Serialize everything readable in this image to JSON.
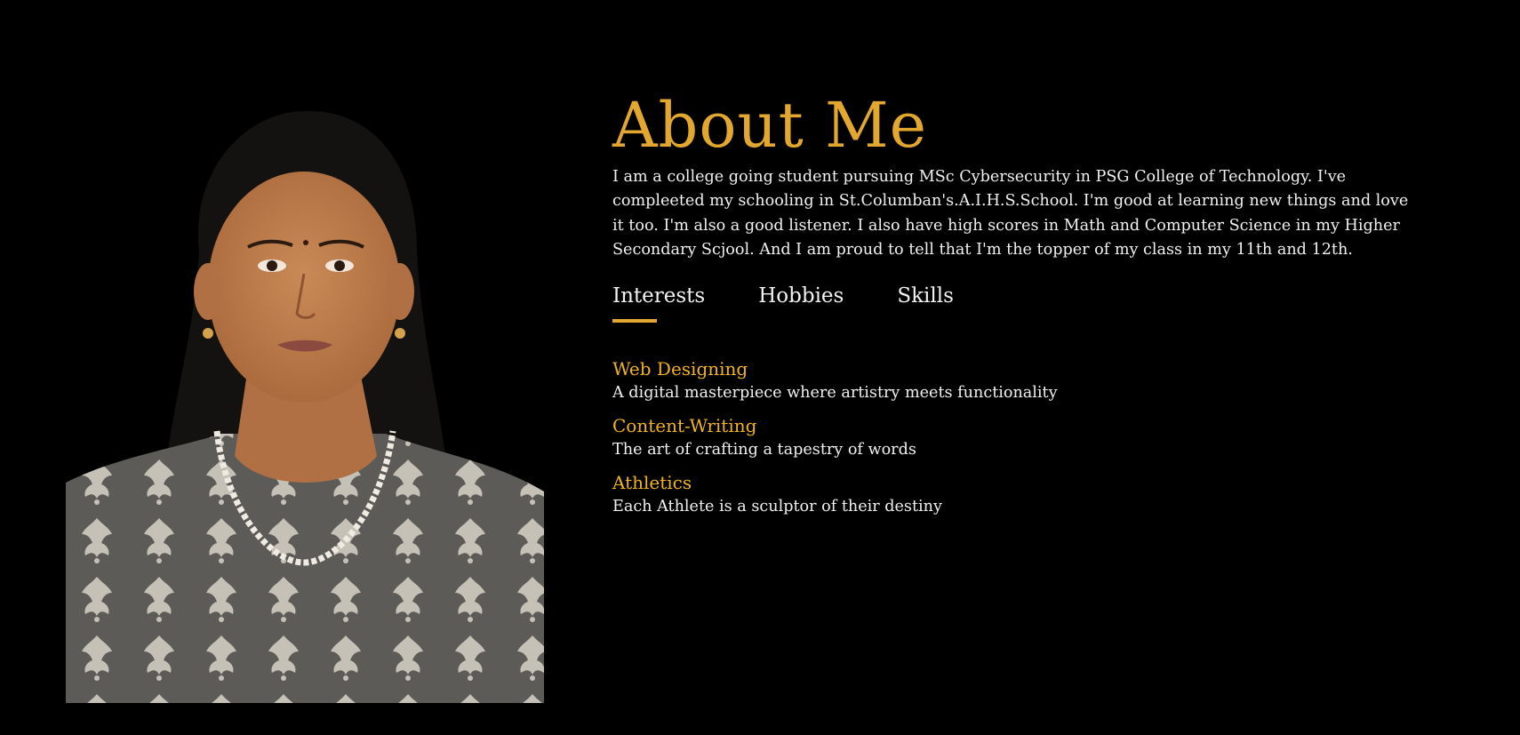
{
  "about": {
    "title": "About Me",
    "bio": "I am a college going student pursuing MSc Cybersecurity in PSG College of Technology. I've compleeted my schooling in St.Columban's.A.I.H.S.School. I'm good at learning new things and love it too. I'm also a good listener. I also have high scores in Math and Computer Science in my Higher Secondary Scjool. And I am proud to tell that I'm the topper of my class in my 11th and 12th."
  },
  "tabs": [
    {
      "label": "Interests",
      "active": true
    },
    {
      "label": "Hobbies",
      "active": false
    },
    {
      "label": "Skills",
      "active": false
    }
  ],
  "interests": [
    {
      "title": "Web Designing",
      "desc": "A digital masterpiece where artistry meets functionality"
    },
    {
      "title": "Content-Writing",
      "desc": "The art of crafting a tapestry of words"
    },
    {
      "title": "Athletics",
      "desc": "Each Athlete is a sculptor of their destiny"
    }
  ],
  "colors": {
    "background": "#000000",
    "accent": "#e2a72e",
    "item_title": "#f0b31a",
    "text": "#f0f0f0"
  }
}
